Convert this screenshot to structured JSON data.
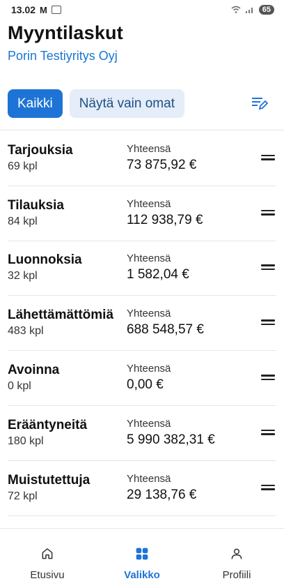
{
  "status": {
    "time": "13.02",
    "battery": "65"
  },
  "header": {
    "title": "Myyntilaskut",
    "company": "Porin Testiyritys Oyj"
  },
  "filters": {
    "all": "Kaikki",
    "own": "Näytä vain omat"
  },
  "rows": [
    {
      "name": "Tarjouksia",
      "count": "69 kpl",
      "label": "Yhteensä",
      "amount": "73 875,92 €"
    },
    {
      "name": "Tilauksia",
      "count": "84 kpl",
      "label": "Yhteensä",
      "amount": "112 938,79 €"
    },
    {
      "name": "Luonnoksia",
      "count": "32 kpl",
      "label": "Yhteensä",
      "amount": "1 582,04 €"
    },
    {
      "name": "Lähettämättömiä",
      "count": "483 kpl",
      "label": "Yhteensä",
      "amount": "688 548,57 €"
    },
    {
      "name": "Avoinna",
      "count": "0 kpl",
      "label": "Yhteensä",
      "amount": "0,00 €"
    },
    {
      "name": "Erääntyneitä",
      "count": "180 kpl",
      "label": "Yhteensä",
      "amount": "5 990 382,31 €"
    },
    {
      "name": "Muistutettuja",
      "count": "72 kpl",
      "label": "Yhteensä",
      "amount": "29 138,76 €"
    }
  ],
  "nav": {
    "home": "Etusivu",
    "menu": "Valikko",
    "profile": "Profiili"
  },
  "colors": {
    "accent": "#1e74d6",
    "chip_inactive": "#e4edf8",
    "subtitle": "#1976d2"
  }
}
